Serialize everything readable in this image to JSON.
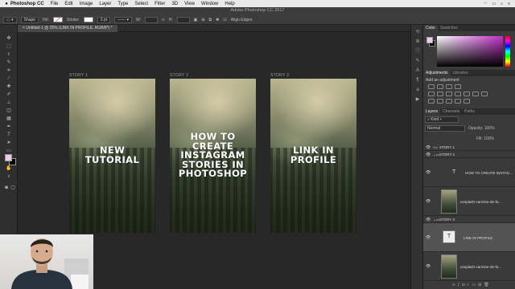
{
  "menubar": {
    "app_name": "Photoshop CC",
    "items": [
      "File",
      "Edit",
      "Image",
      "Layer",
      "Type",
      "Select",
      "Filter",
      "3D",
      "View",
      "Window",
      "Help"
    ]
  },
  "window": {
    "title": "Adobe Photoshop CC 2017"
  },
  "options_bar": {
    "tool_mode": "Shape",
    "fill_label": "Fill:",
    "stroke_label": "Stroke:",
    "stroke_width": "3 pt",
    "w_label": "W:",
    "h_label": "H:",
    "align_edges_label": "Align Edges"
  },
  "document_tab": {
    "label": "Untitled-1 @ 25% (LINK IN PROFILE, RGB/8*) *"
  },
  "artboards": [
    {
      "label": "STORY 1",
      "headline": "NEW\nTUTORIAL"
    },
    {
      "label": "STORY 2",
      "headline": "HOW TO\nCREATE\nINSTAGRAM\nSTORIES IN\nPHOTOSHOP"
    },
    {
      "label": "STORY 3",
      "headline": "LINK IN\nPROFILE"
    }
  ],
  "color_panel": {
    "tabs": [
      "Color",
      "Swatches"
    ],
    "foreground": "#e9cfe6",
    "background": "#000000"
  },
  "adjustments_panel": {
    "tabs": [
      "Adjustments",
      "Libraries"
    ],
    "heading": "Add an adjustment"
  },
  "layers_panel": {
    "tabs": [
      "Layers",
      "Channels",
      "Paths"
    ],
    "filter": "Kind",
    "blend_mode": "Normal",
    "opacity_label": "Opacity:",
    "opacity": "100%",
    "fill_label": "Fill:",
    "fill": "100%",
    "layers": [
      {
        "name": "STORY 1",
        "kind": "group"
      },
      {
        "name": "STORY 2",
        "kind": "group"
      },
      {
        "name": "HOW TO CREATE INSTAG...",
        "kind": "text"
      },
      {
        "name": "unsplash-carmine-de-fa...",
        "kind": "image"
      },
      {
        "name": "STORY 3",
        "kind": "group"
      },
      {
        "name": "LINK IN PROFILE",
        "kind": "text"
      },
      {
        "name": "unsplash-carmine-de-fa...",
        "kind": "image"
      }
    ]
  }
}
